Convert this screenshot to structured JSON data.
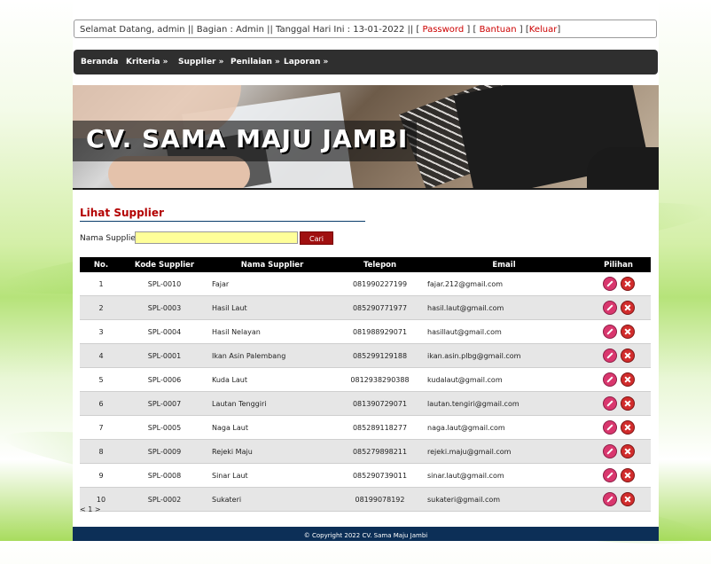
{
  "topbar": {
    "welcome": "Selamat Datang, admin || Bagian : Admin || Tanggal Hari Ini : 13-01-2022 || [ ",
    "password": "Password",
    "sep1": " ] [ ",
    "help": "Bantuan",
    "sep2": " ] [",
    "logout": "Keluar",
    "end": "]"
  },
  "nav": [
    "Beranda",
    "Kriteria »",
    "Supplier »",
    "Penilaian »",
    "Laporan »"
  ],
  "banner": {
    "title": "CV. SAMA MAJU JAMBI"
  },
  "page_heading": "Lihat Supplier",
  "search": {
    "label": "Nama Supplier :",
    "value": "",
    "button": "Cari"
  },
  "table": {
    "headers": [
      "No.",
      "Kode Supplier",
      "Nama Supplier",
      "Telepon",
      "Email",
      "Pilihan"
    ],
    "rows": [
      {
        "no": "1",
        "kode": "SPL-0010",
        "nama": "Fajar",
        "telepon": "081990227199",
        "email": "fajar.212@gmail.com"
      },
      {
        "no": "2",
        "kode": "SPL-0003",
        "nama": "Hasil Laut",
        "telepon": "085290771977",
        "email": "hasil.laut@gmail.com"
      },
      {
        "no": "3",
        "kode": "SPL-0004",
        "nama": "Hasil Nelayan",
        "telepon": "081988929071",
        "email": "hasillaut@gmail.com"
      },
      {
        "no": "4",
        "kode": "SPL-0001",
        "nama": "Ikan Asin Palembang",
        "telepon": "085299129188",
        "email": "ikan.asin.plbg@gmail.com"
      },
      {
        "no": "5",
        "kode": "SPL-0006",
        "nama": "Kuda Laut",
        "telepon": "0812938290388",
        "email": "kudalaut@gmail.com"
      },
      {
        "no": "6",
        "kode": "SPL-0007",
        "nama": "Lautan Tenggiri",
        "telepon": "081390729071",
        "email": "lautan.tengiri@gmail.com"
      },
      {
        "no": "7",
        "kode": "SPL-0005",
        "nama": "Naga Laut",
        "telepon": "085289118277",
        "email": "naga.laut@gmail.com"
      },
      {
        "no": "8",
        "kode": "SPL-0009",
        "nama": "Rejeki Maju",
        "telepon": "085279898211",
        "email": "rejeki.maju@gmail.com"
      },
      {
        "no": "9",
        "kode": "SPL-0008",
        "nama": "Sinar Laut",
        "telepon": "085290739011",
        "email": "sinar.laut@gmail.com"
      },
      {
        "no": "10",
        "kode": "SPL-0002",
        "nama": "Sukateri",
        "telepon": "08199078192",
        "email": "sukateri@gmail.com"
      }
    ],
    "actions": {
      "edit_icon": "pencil-edit-icon",
      "delete_icon": "close-delete-icon"
    }
  },
  "pager": "< 1 >",
  "footer": "© Copyright 2022 CV. Sama Maju Jambi",
  "colors": {
    "nav_bg": "#2f2f2f",
    "accent_red": "#b30000",
    "footer_bg": "#0c2f57",
    "search_bg": "#ffff99"
  }
}
